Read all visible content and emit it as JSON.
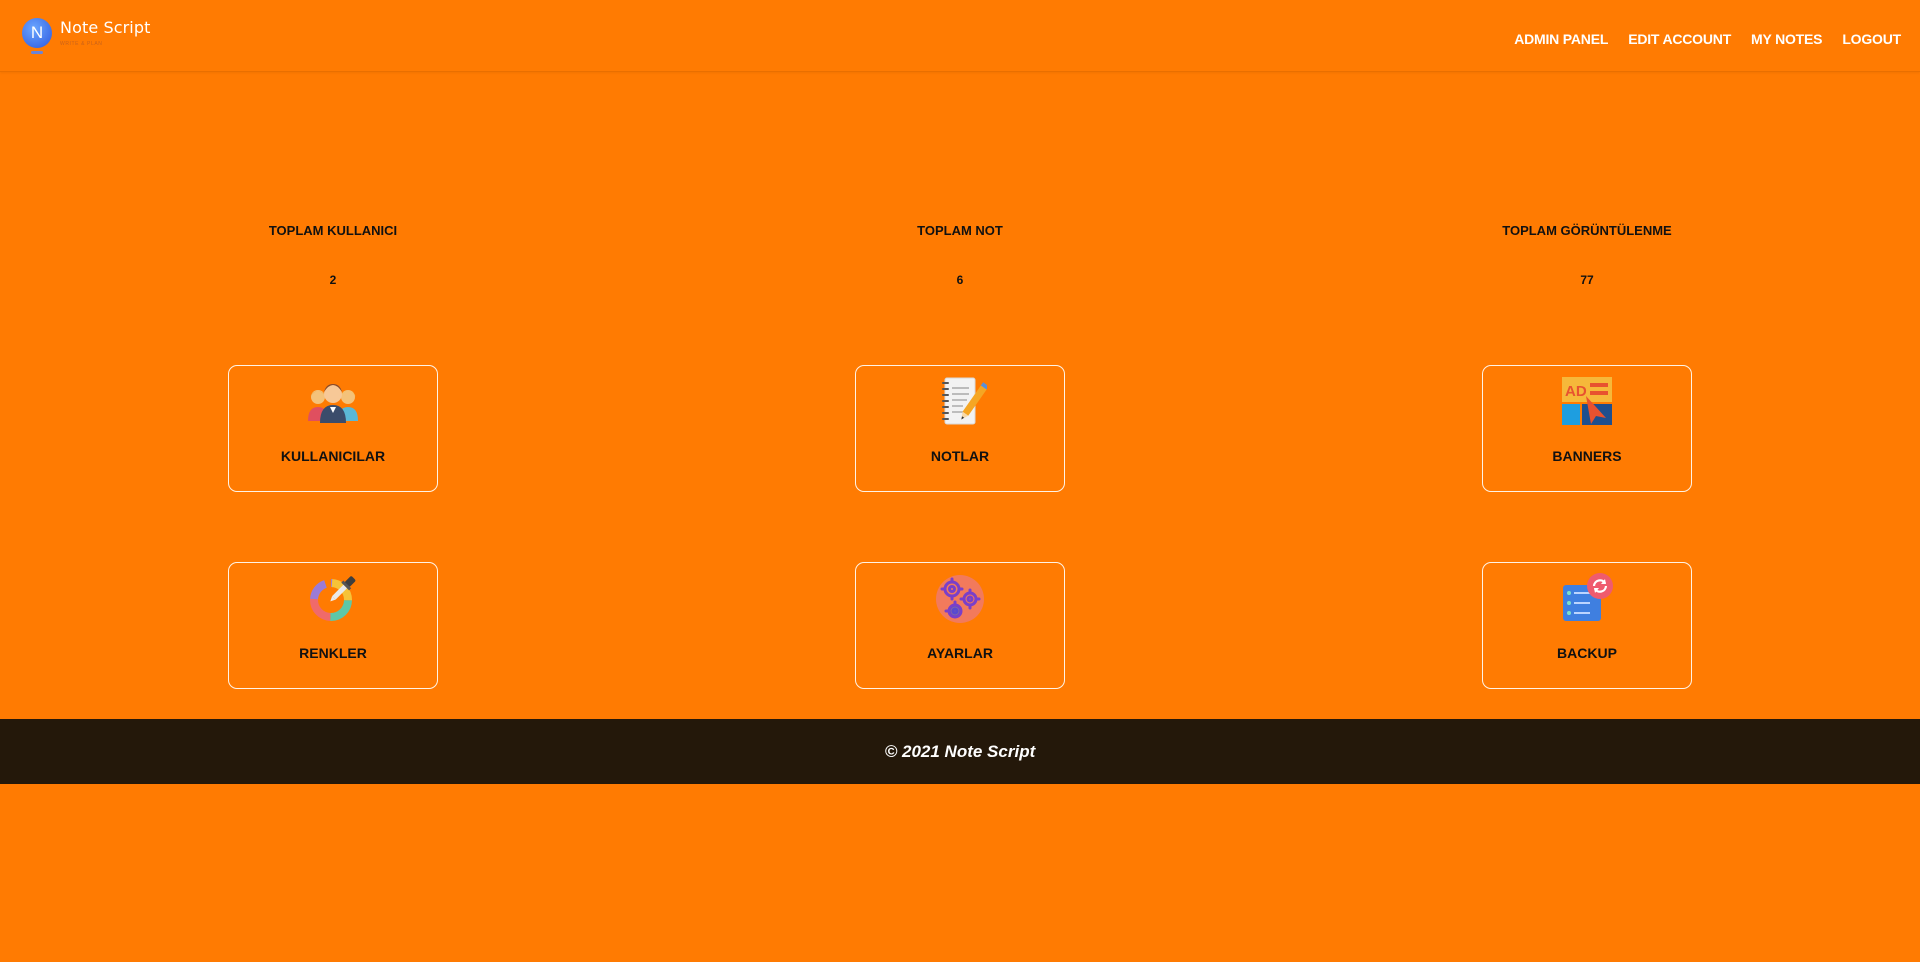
{
  "brand": {
    "logo_letter": "N",
    "name": "Note Script",
    "tagline": "WRITE & PLAN"
  },
  "nav": [
    {
      "label": "ADMIN PANEL"
    },
    {
      "label": "EDIT ACCOUNT"
    },
    {
      "label": "MY NOTES"
    },
    {
      "label": "LOGOUT"
    }
  ],
  "stats": [
    {
      "label": "TOPLAM KULLANICI",
      "value": "2"
    },
    {
      "label": "TOPLAM NOT",
      "value": "6"
    },
    {
      "label": "TOPLAM GÖRÜNTÜLENME",
      "value": "77"
    }
  ],
  "cards": [
    {
      "label": "KULLANICILAR",
      "icon": "users-icon"
    },
    {
      "label": "NOTLAR",
      "icon": "notepad-icon"
    },
    {
      "label": "BANNERS",
      "icon": "ad-banner-icon"
    },
    {
      "label": "RENKLER",
      "icon": "color-picker-icon"
    },
    {
      "label": "AYARLAR",
      "icon": "gears-icon"
    },
    {
      "label": "BACKUP",
      "icon": "backup-icon"
    }
  ],
  "footer": {
    "text": "© 2021 Note Script"
  },
  "colors": {
    "background": "#ff7b02",
    "footer": "#24180a",
    "logo_blue": "#3f6fe8"
  }
}
